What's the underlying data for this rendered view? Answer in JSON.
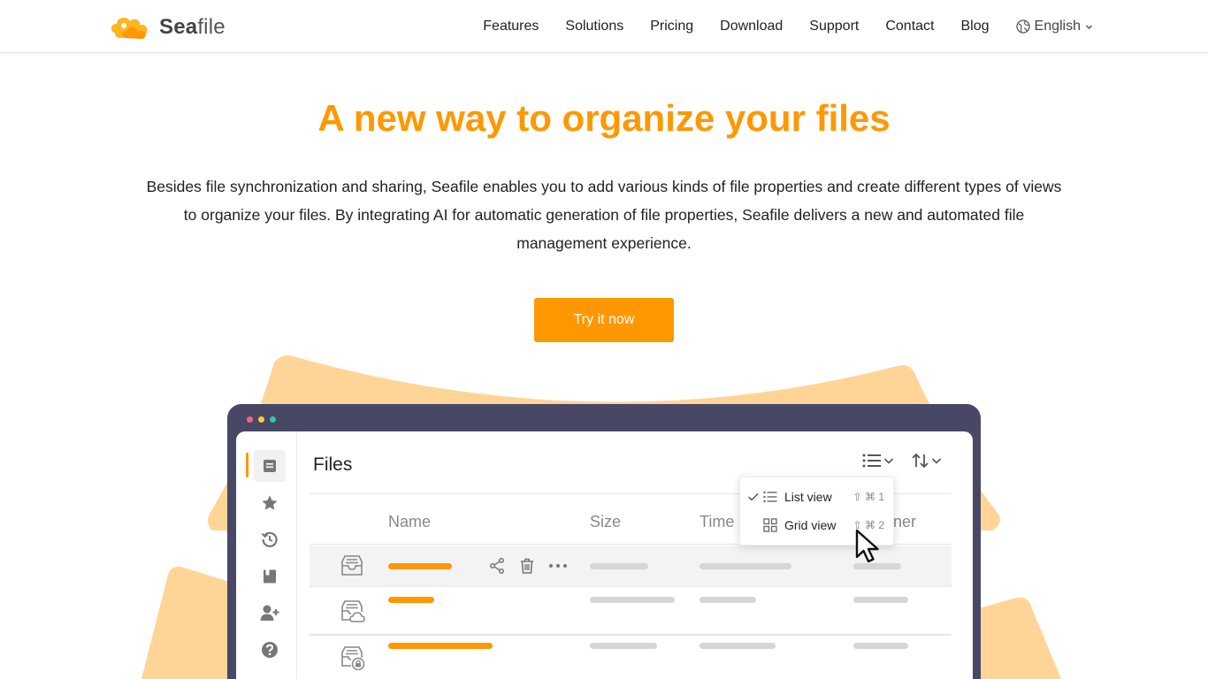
{
  "brand": {
    "name_prefix": "Sea",
    "name_suffix": "file"
  },
  "nav": {
    "items": [
      "Features",
      "Solutions",
      "Pricing",
      "Download",
      "Support",
      "Contact",
      "Blog"
    ],
    "language": "English"
  },
  "hero": {
    "title": "A new way to organize your files",
    "description": "Besides file synchronization and sharing, Seafile enables you to add various kinds of file properties and create different types of views to organize your files. By integrating AI for automatic generation of file properties, Seafile delivers a new and automated file management experience.",
    "cta": "Try it now"
  },
  "app": {
    "title": "Files",
    "columns": {
      "name": "Name",
      "size": "Size",
      "time": "Time",
      "owner": "ner"
    },
    "view_menu": {
      "list_label": "List view",
      "list_shortcut": "⇧ ⌘ 1",
      "grid_label": "Grid view",
      "grid_shortcut": "⇧ ⌘ 2"
    }
  },
  "colors": {
    "accent": "#ff9800",
    "device_frame": "#484866",
    "deco": "#ffd597",
    "placeholder": "#d6d6d6"
  }
}
